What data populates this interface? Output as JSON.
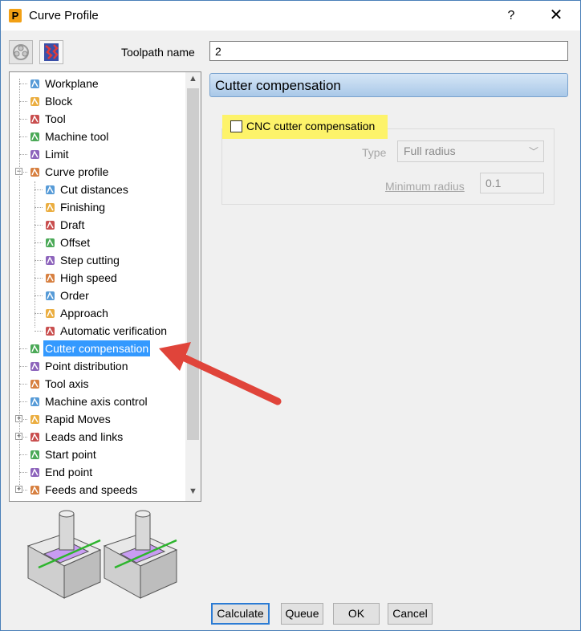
{
  "window": {
    "title": "Curve Profile",
    "help": "?",
    "close": "✕",
    "app_icon": "P"
  },
  "toolpath": {
    "label": "Toolpath name",
    "value": "2"
  },
  "tree": {
    "items": [
      {
        "label": "Workplane",
        "icon": "workplane-icon",
        "level": 0
      },
      {
        "label": "Block",
        "icon": "block-icon",
        "level": 0
      },
      {
        "label": "Tool",
        "icon": "tool-icon",
        "level": 0
      },
      {
        "label": "Machine tool",
        "icon": "machine-tool-icon",
        "level": 0
      },
      {
        "label": "Limit",
        "icon": "limit-icon",
        "level": 0
      },
      {
        "label": "Curve profile",
        "icon": "curve-profile-icon",
        "level": 0,
        "expander": "−"
      },
      {
        "label": "Cut distances",
        "icon": "cut-distances-icon",
        "level": 1
      },
      {
        "label": "Finishing",
        "icon": "finishing-icon",
        "level": 1
      },
      {
        "label": "Draft",
        "icon": "draft-icon",
        "level": 1
      },
      {
        "label": "Offset",
        "icon": "offset-icon",
        "level": 1
      },
      {
        "label": "Step cutting",
        "icon": "step-cutting-icon",
        "level": 1
      },
      {
        "label": "High speed",
        "icon": "high-speed-icon",
        "level": 1
      },
      {
        "label": "Order",
        "icon": "order-icon",
        "level": 1
      },
      {
        "label": "Approach",
        "icon": "approach-icon",
        "level": 1
      },
      {
        "label": "Automatic verification",
        "icon": "automatic-verification-icon",
        "level": 1
      },
      {
        "label": "Cutter compensation",
        "icon": "cutter-compensation-icon",
        "level": 0,
        "selected": true
      },
      {
        "label": "Point distribution",
        "icon": "point-distribution-icon",
        "level": 0
      },
      {
        "label": "Tool axis",
        "icon": "tool-axis-icon",
        "level": 0
      },
      {
        "label": "Machine axis control",
        "icon": "machine-axis-control-icon",
        "level": 0
      },
      {
        "label": "Rapid Moves",
        "icon": "rapid-moves-icon",
        "level": 0,
        "expander": "+"
      },
      {
        "label": "Leads and links",
        "icon": "leads-and-links-icon",
        "level": 0,
        "expander": "+"
      },
      {
        "label": "Start point",
        "icon": "start-point-icon",
        "level": 0
      },
      {
        "label": "End point",
        "icon": "end-point-icon",
        "level": 0
      },
      {
        "label": "Feeds and speeds",
        "icon": "feeds-and-speeds-icon",
        "level": 0,
        "expander": "+"
      }
    ],
    "selected_color": "#3399ff"
  },
  "section": {
    "title": "Cutter compensation",
    "cnc_label": "CNC cutter compensation",
    "cnc_checked": false,
    "highlight_color": "#fdf36a",
    "type_label": "Type",
    "type_value": "Full radius",
    "min_radius_label": "Minimum radius",
    "min_radius_value": "0.1"
  },
  "buttons": {
    "calculate": "Calculate",
    "queue": "Queue",
    "ok": "OK",
    "cancel": "Cancel"
  },
  "colors": {
    "arrow": "#e0443a",
    "preview_face": "#c89cf2",
    "preview_line": "#2db52d"
  }
}
